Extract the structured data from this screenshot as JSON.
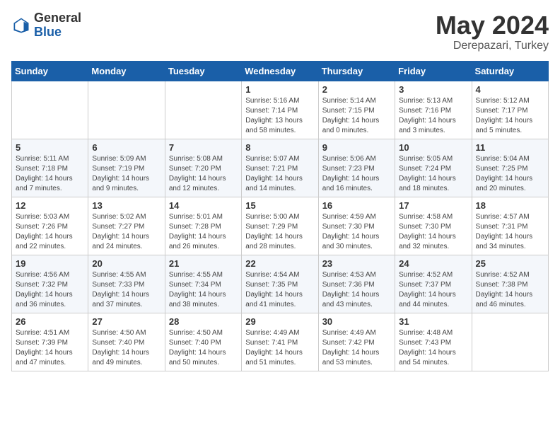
{
  "header": {
    "logo_general": "General",
    "logo_blue": "Blue",
    "main_title": "May 2024",
    "subtitle": "Derepazari, Turkey"
  },
  "weekdays": [
    "Sunday",
    "Monday",
    "Tuesday",
    "Wednesday",
    "Thursday",
    "Friday",
    "Saturday"
  ],
  "weeks": [
    [
      {
        "day": "",
        "info": ""
      },
      {
        "day": "",
        "info": ""
      },
      {
        "day": "",
        "info": ""
      },
      {
        "day": "1",
        "info": "Sunrise: 5:16 AM\nSunset: 7:14 PM\nDaylight: 13 hours\nand 58 minutes."
      },
      {
        "day": "2",
        "info": "Sunrise: 5:14 AM\nSunset: 7:15 PM\nDaylight: 14 hours\nand 0 minutes."
      },
      {
        "day": "3",
        "info": "Sunrise: 5:13 AM\nSunset: 7:16 PM\nDaylight: 14 hours\nand 3 minutes."
      },
      {
        "day": "4",
        "info": "Sunrise: 5:12 AM\nSunset: 7:17 PM\nDaylight: 14 hours\nand 5 minutes."
      }
    ],
    [
      {
        "day": "5",
        "info": "Sunrise: 5:11 AM\nSunset: 7:18 PM\nDaylight: 14 hours\nand 7 minutes."
      },
      {
        "day": "6",
        "info": "Sunrise: 5:09 AM\nSunset: 7:19 PM\nDaylight: 14 hours\nand 9 minutes."
      },
      {
        "day": "7",
        "info": "Sunrise: 5:08 AM\nSunset: 7:20 PM\nDaylight: 14 hours\nand 12 minutes."
      },
      {
        "day": "8",
        "info": "Sunrise: 5:07 AM\nSunset: 7:21 PM\nDaylight: 14 hours\nand 14 minutes."
      },
      {
        "day": "9",
        "info": "Sunrise: 5:06 AM\nSunset: 7:23 PM\nDaylight: 14 hours\nand 16 minutes."
      },
      {
        "day": "10",
        "info": "Sunrise: 5:05 AM\nSunset: 7:24 PM\nDaylight: 14 hours\nand 18 minutes."
      },
      {
        "day": "11",
        "info": "Sunrise: 5:04 AM\nSunset: 7:25 PM\nDaylight: 14 hours\nand 20 minutes."
      }
    ],
    [
      {
        "day": "12",
        "info": "Sunrise: 5:03 AM\nSunset: 7:26 PM\nDaylight: 14 hours\nand 22 minutes."
      },
      {
        "day": "13",
        "info": "Sunrise: 5:02 AM\nSunset: 7:27 PM\nDaylight: 14 hours\nand 24 minutes."
      },
      {
        "day": "14",
        "info": "Sunrise: 5:01 AM\nSunset: 7:28 PM\nDaylight: 14 hours\nand 26 minutes."
      },
      {
        "day": "15",
        "info": "Sunrise: 5:00 AM\nSunset: 7:29 PM\nDaylight: 14 hours\nand 28 minutes."
      },
      {
        "day": "16",
        "info": "Sunrise: 4:59 AM\nSunset: 7:30 PM\nDaylight: 14 hours\nand 30 minutes."
      },
      {
        "day": "17",
        "info": "Sunrise: 4:58 AM\nSunset: 7:30 PM\nDaylight: 14 hours\nand 32 minutes."
      },
      {
        "day": "18",
        "info": "Sunrise: 4:57 AM\nSunset: 7:31 PM\nDaylight: 14 hours\nand 34 minutes."
      }
    ],
    [
      {
        "day": "19",
        "info": "Sunrise: 4:56 AM\nSunset: 7:32 PM\nDaylight: 14 hours\nand 36 minutes."
      },
      {
        "day": "20",
        "info": "Sunrise: 4:55 AM\nSunset: 7:33 PM\nDaylight: 14 hours\nand 37 minutes."
      },
      {
        "day": "21",
        "info": "Sunrise: 4:55 AM\nSunset: 7:34 PM\nDaylight: 14 hours\nand 38 minutes."
      },
      {
        "day": "22",
        "info": "Sunrise: 4:54 AM\nSunset: 7:35 PM\nDaylight: 14 hours\nand 41 minutes."
      },
      {
        "day": "23",
        "info": "Sunrise: 4:53 AM\nSunset: 7:36 PM\nDaylight: 14 hours\nand 43 minutes."
      },
      {
        "day": "24",
        "info": "Sunrise: 4:52 AM\nSunset: 7:37 PM\nDaylight: 14 hours\nand 44 minutes."
      },
      {
        "day": "25",
        "info": "Sunrise: 4:52 AM\nSunset: 7:38 PM\nDaylight: 14 hours\nand 46 minutes."
      }
    ],
    [
      {
        "day": "26",
        "info": "Sunrise: 4:51 AM\nSunset: 7:39 PM\nDaylight: 14 hours\nand 47 minutes."
      },
      {
        "day": "27",
        "info": "Sunrise: 4:50 AM\nSunset: 7:40 PM\nDaylight: 14 hours\nand 49 minutes."
      },
      {
        "day": "28",
        "info": "Sunrise: 4:50 AM\nSunset: 7:40 PM\nDaylight: 14 hours\nand 50 minutes."
      },
      {
        "day": "29",
        "info": "Sunrise: 4:49 AM\nSunset: 7:41 PM\nDaylight: 14 hours\nand 51 minutes."
      },
      {
        "day": "30",
        "info": "Sunrise: 4:49 AM\nSunset: 7:42 PM\nDaylight: 14 hours\nand 53 minutes."
      },
      {
        "day": "31",
        "info": "Sunrise: 4:48 AM\nSunset: 7:43 PM\nDaylight: 14 hours\nand 54 minutes."
      },
      {
        "day": "",
        "info": ""
      }
    ]
  ]
}
